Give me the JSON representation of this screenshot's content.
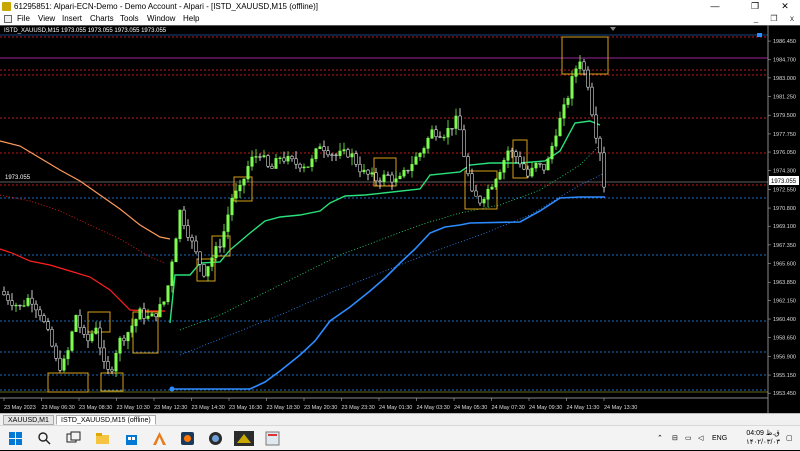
{
  "window": {
    "title": "61295851: Alpari-ECN-Demo - Demo Account - Alpari - [ISTD_XAUUSD,M15 (offline)]",
    "minimize": "—",
    "maximize": "❐",
    "close": "✕"
  },
  "menu": {
    "items": [
      "File",
      "View",
      "Insert",
      "Charts",
      "Tools",
      "Window",
      "Help"
    ],
    "mdi_minimize": "_",
    "mdi_restore": "❐",
    "mdi_close": "x"
  },
  "chart": {
    "title": "ISTD_XAUUSD,M15  1973.055 1973.055 1973.055 1973.055",
    "current_price_left": "1973.055",
    "current_price_badge": "1973.055"
  },
  "chart_data": {
    "type": "candlestick",
    "symbol": "ISTD_XAUUSD",
    "timeframe": "M15",
    "y_ticks": [
      1986.45,
      1984.7,
      1983.0,
      1981.25,
      1979.5,
      1977.75,
      1976.05,
      1974.3,
      1972.55,
      1970.8,
      1969.1,
      1967.35,
      1965.6,
      1963.85,
      1962.15,
      1960.4,
      1958.65,
      1956.9,
      1955.15,
      1953.45
    ],
    "y_tick_labels": [
      "1986.450",
      "1984.700",
      "1983.000",
      "1981.250",
      "1979.500",
      "1977.750",
      "1976.050",
      "1974.300",
      "1972.550",
      "1970.800",
      "1969.100",
      "1967.350",
      "1965.600",
      "1963.850",
      "1962.150",
      "1960.400",
      "1958.650",
      "1956.900",
      "1955.150",
      "1953.450"
    ],
    "ylim": [
      1953.0,
      1987.3
    ],
    "x_ticks": [
      "23 May 2023",
      "23 May 06:30",
      "23 May 08:30",
      "23 May 10:30",
      "23 May 12:30",
      "23 May 14:30",
      "23 May 16:30",
      "23 May 18:30",
      "23 May 20:30",
      "23 May 23:30",
      "24 May 01:30",
      "24 May 03:30",
      "24 May 05:30",
      "24 May 07:30",
      "24 May 09:30",
      "24 May 11:30",
      "24 May 13:30"
    ],
    "last_price": 1973.055,
    "colors": {
      "bull": "#7cfc52",
      "bear": "#ffffff",
      "box": "#d4a017",
      "support_band": "#2d8cff",
      "trail_green": "#29e07a",
      "resist_red": "#ff2020",
      "resist_orange": "#ff9a5a"
    }
  },
  "tabs": [
    "XAUUSD,M1",
    "ISTD_XAUUSD,M15 (offline)"
  ],
  "taskbar": {
    "language": "ENG",
    "time": "04:09 ق.ظ",
    "date": "۱۴۰۲/۰۳/۰۳"
  }
}
